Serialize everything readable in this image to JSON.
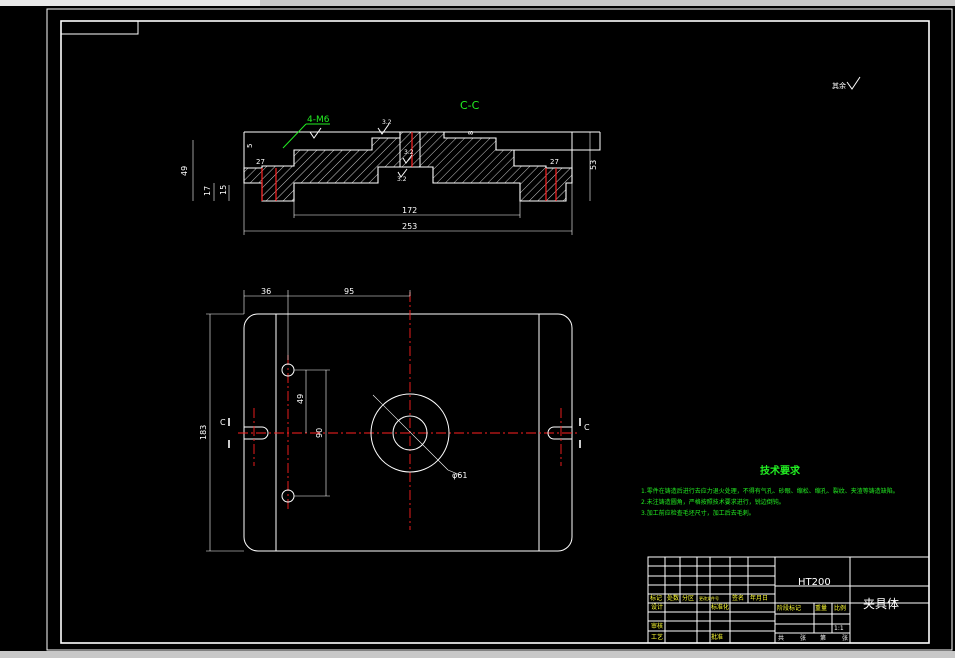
{
  "section_label": "C-C",
  "thread_label": "4-M6",
  "surface_symbol": "其余",
  "dims_section": {
    "d_27_left": "27",
    "d_27_right": "27",
    "d_49": "49",
    "d_53": "53",
    "d_17": "17",
    "d_15": "15",
    "d_172": "172",
    "d_253": "253",
    "d_8": "8",
    "d_5": "5",
    "ra_1": "3.2",
    "ra_2": "3.2",
    "ra_3": "3.2"
  },
  "dims_plan": {
    "d_36": "36",
    "d_95": "95",
    "d_183": "183",
    "d_49": "49",
    "d_90": "90",
    "d_phi61": "φ61",
    "c_left": "C",
    "c_right": "C"
  },
  "tech_requirements": {
    "title": "技术要求",
    "lines": [
      "1.零件在铸造后进行去应力退火处理，不得有气孔、砂眼、缩松、缩孔、裂纹、夹渣等铸造缺陷。",
      "2.未注铸造圆角，严格按照技术要求进行，锐边倒钝。",
      "3.加工前应检查毛坯尺寸，加工后去毛刺。"
    ]
  },
  "title_block": {
    "material": "HT200",
    "part_name": "夹具体",
    "scale": "1:1",
    "header_cells": [
      "标记",
      "处数",
      "分区",
      "更改文件号",
      "签名",
      "年月日"
    ],
    "row_labels": [
      "设计",
      "标准化",
      "审核",
      "工艺",
      "批准"
    ],
    "mid_labels": [
      "阶段标记",
      "重量",
      "比例"
    ],
    "sheet_labels": [
      "共",
      "张",
      "第",
      "张"
    ]
  }
}
